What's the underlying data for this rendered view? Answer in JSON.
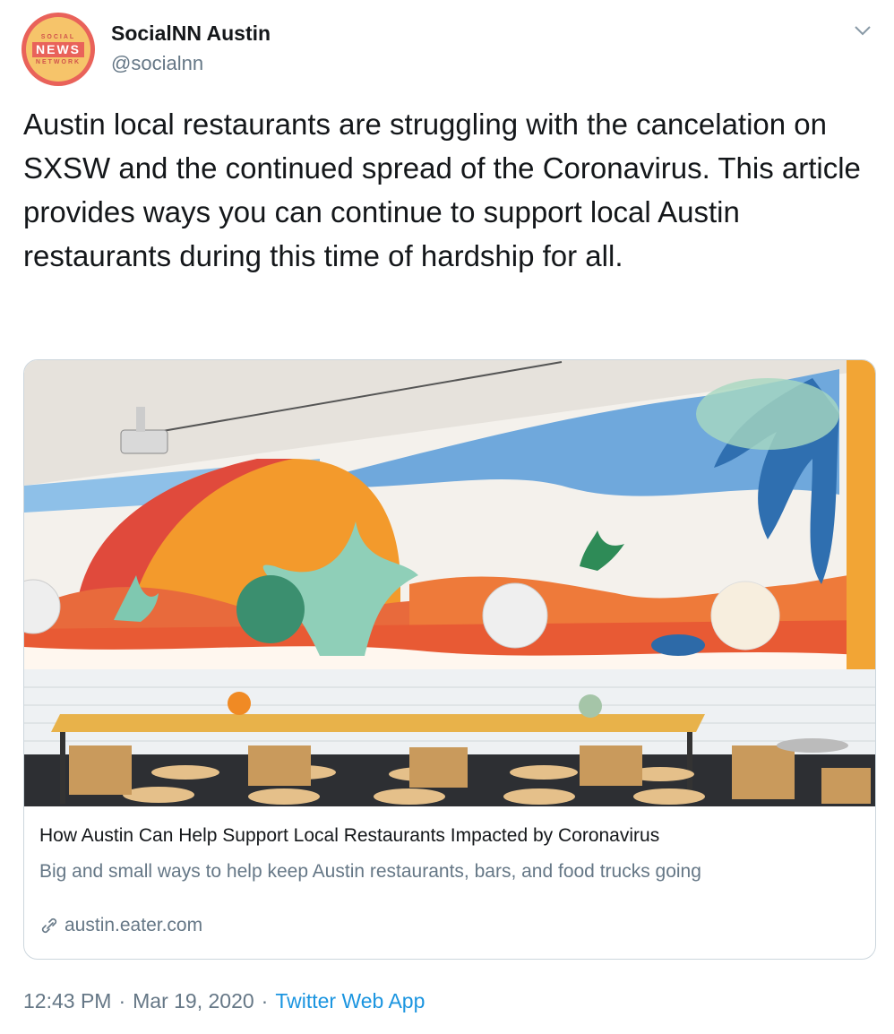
{
  "account": {
    "name": "SocialNN Austin",
    "handle": "@socialnn",
    "avatar": {
      "top_text": "SOCIAL",
      "main_text": "NEWS",
      "bottom_text": "NETWORK"
    }
  },
  "tweet": {
    "text": "Austin local restaurants are struggling with the cancelation on SXSW and the continued spread of the Coronavirus. This article provides ways you can continue to support local Austin restaurants during this time of hardship for all."
  },
  "card": {
    "title": "How Austin Can Help Support Local Restaurants Impacted by Coronavirus",
    "description": "Big and small ways to help keep Austin restaurants, bars, and food trucks going",
    "domain": "austin.eater.com"
  },
  "meta": {
    "time": "12:43 PM",
    "date": "Mar 19, 2020",
    "separator": "·",
    "source": "Twitter Web App"
  },
  "icons": {
    "menu": "chevron-down-icon",
    "link": "link-icon"
  },
  "colors": {
    "accent": "#1b95e0",
    "secondary_text": "#657786",
    "primary_text": "#14171a",
    "border": "#ccd6dd"
  }
}
